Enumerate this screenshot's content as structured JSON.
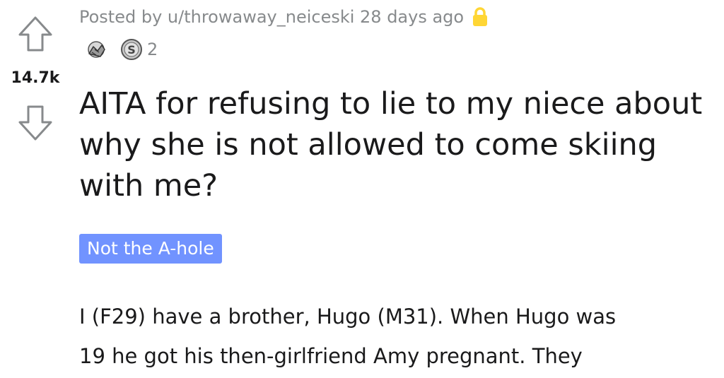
{
  "post": {
    "meta": {
      "posted_by": "Posted by u/throwaway_neiceski 28 days ago",
      "lock_icon": "lock-icon"
    },
    "awards": [
      {
        "icon": "wholesome-hands-award-icon"
      },
      {
        "icon": "silver-coin-award-icon",
        "count": "2"
      }
    ],
    "score": "14.7k",
    "title": "AITA for refusing to lie to my niece about why she is not allowed to come skiing with me?",
    "flair": "Not the A-hole",
    "body_lines": [
      "I (F29) have a brother, Hugo (M31). When Hugo was",
      "19 he got his then-girlfriend Amy pregnant. They"
    ]
  },
  "colors": {
    "flair_bg": "#7193ff",
    "meta_text": "#878a8c",
    "lock": "#ffd635"
  }
}
